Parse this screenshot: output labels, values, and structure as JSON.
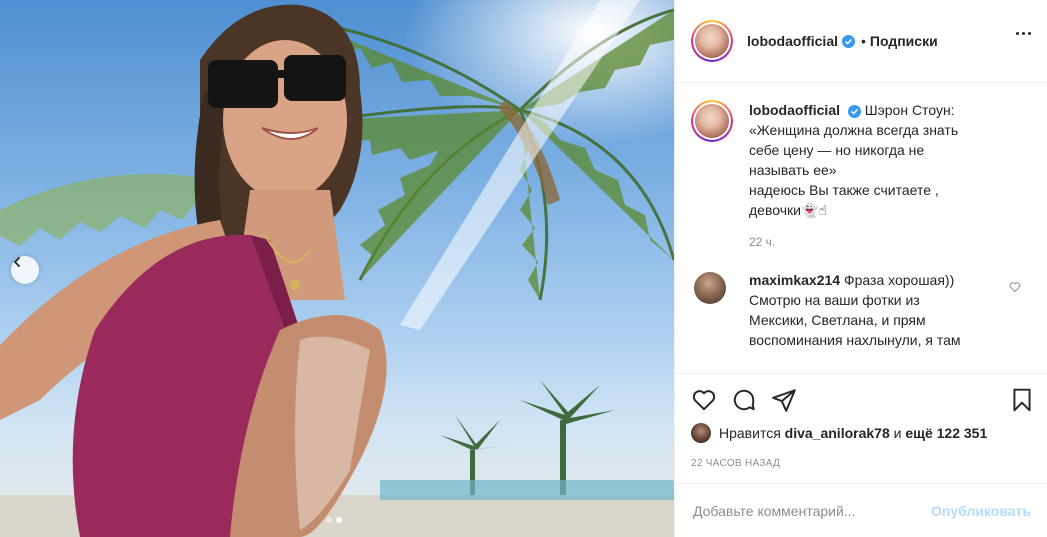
{
  "post": {
    "username": "lobodaofficial",
    "follow_separator": "•",
    "follow_label": "Подписки",
    "more_icon": "more-dots-icon",
    "caption": {
      "username": "lobodaofficial",
      "lines": [
        "Шэрон Стоун:",
        "«Женщина должна всегда знать",
        "себе цену — но никогда не",
        "называть ее»",
        "надеюсь Вы также считаете ,",
        "девочки👻☝"
      ],
      "time": "22 ч."
    },
    "comment": {
      "username": "maximkax214",
      "text_lines": [
        "Фраза хорошая))",
        "Смотрю на ваши фотки из",
        "Мексики, Светлана, и прям",
        "воспоминания нахлынули, я там"
      ]
    },
    "likes": {
      "prefix": "Нравится",
      "user": "diva_anilorak78",
      "conj": "и",
      "rest": "ещё 122 351"
    },
    "timestamp": "22 ЧАСОВ НАЗАД",
    "add_comment": {
      "placeholder": "Добавьте комментарий...",
      "post_label": "Опубликовать"
    },
    "carousel": {
      "total": 2,
      "active": 2
    }
  },
  "colors": {
    "text": "#262626",
    "muted": "#8e8e8e",
    "verified": "#3897f0",
    "post_disabled": "#b3dbff",
    "swimsuit": "#9b2a5c"
  }
}
